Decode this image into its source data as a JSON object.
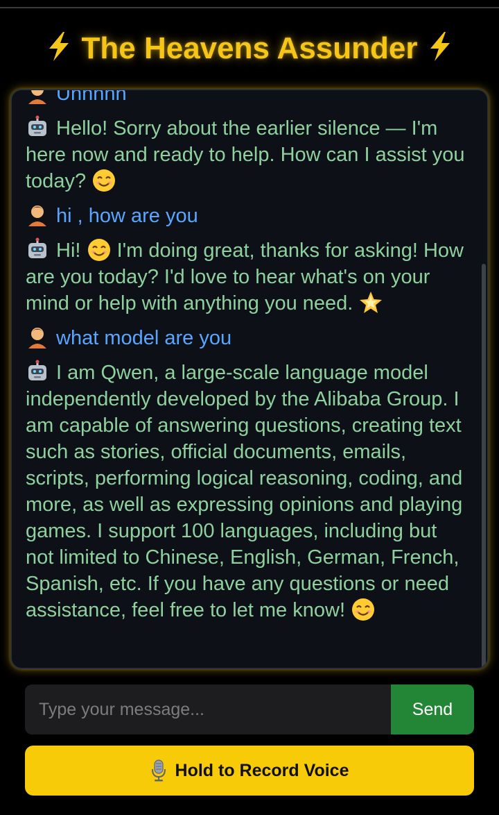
{
  "app": {
    "title": "The Heavens Assunder",
    "title_icon": "lightning-bolt-icon",
    "accent_color": "#f5c518"
  },
  "chat": {
    "messages": [
      {
        "role": "user",
        "avatar": "person-icon",
        "text": "Uhhhhh"
      },
      {
        "role": "bot",
        "avatar": "robot-icon",
        "text": "Hello! Sorry about the earlier silence — I'm here now and ready to help. How can I assist you today?",
        "trailing_emoji": "smiling-face-icon"
      },
      {
        "role": "user",
        "avatar": "person-icon",
        "text": "hi , how are you"
      },
      {
        "role": "bot",
        "avatar": "robot-icon",
        "text_before_emoji": "Hi!",
        "mid_emoji": "smiling-face-icon",
        "text": "I'm doing great, thanks for asking! How are you today? I'd love to hear what's on your mind or help with anything you need.",
        "trailing_emoji": "glowing-star-icon"
      },
      {
        "role": "user",
        "avatar": "person-icon",
        "text": "what model are you"
      },
      {
        "role": "bot",
        "avatar": "robot-icon",
        "text": "I am Qwen, a large-scale language model independently developed by the Alibaba Group. I am capable of answering questions, creating text such as stories, official documents, emails, scripts, performing logical reasoning, coding, and more, as well as expressing opinions and playing games. I support 100 languages, including but not limited to Chinese, English, German, French, Spanish, etc. If you have any questions or need assistance, feel free to let me know!",
        "trailing_emoji": "smiling-face-icon"
      }
    ],
    "user_text_color": "#58a6ff",
    "bot_text_color": "#8fd19e"
  },
  "composer": {
    "placeholder": "Type your message...",
    "value": "",
    "send_label": "Send",
    "send_color": "#238636"
  },
  "voice": {
    "label": "Hold to Record Voice",
    "icon": "microphone-icon",
    "color": "#f7cb08"
  }
}
